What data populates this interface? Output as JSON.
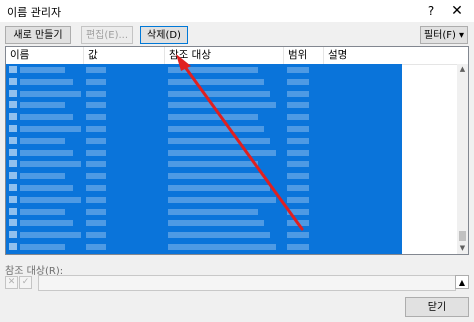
{
  "window": {
    "title": "이름 관리자",
    "help_glyph": "?",
    "close_glyph": "✕"
  },
  "toolbar": {
    "new_label": "새로 만들기(N)...",
    "edit_label": "편집(E)...",
    "delete_label": "삭제(D)",
    "filter_label": "필터(F) ▾"
  },
  "table": {
    "columns": [
      "이름",
      "값",
      "참조 대상",
      "범위",
      "설명"
    ],
    "row_count": 16,
    "selection_color": "#0a74da",
    "cell_content": "blurred"
  },
  "refers_to": {
    "label": "참조 대상(R):",
    "value": ""
  },
  "footer": {
    "close_label": "닫기"
  },
  "annotation": {
    "type": "red-arrow",
    "color": "#e02020",
    "points_to": "delete-button"
  }
}
